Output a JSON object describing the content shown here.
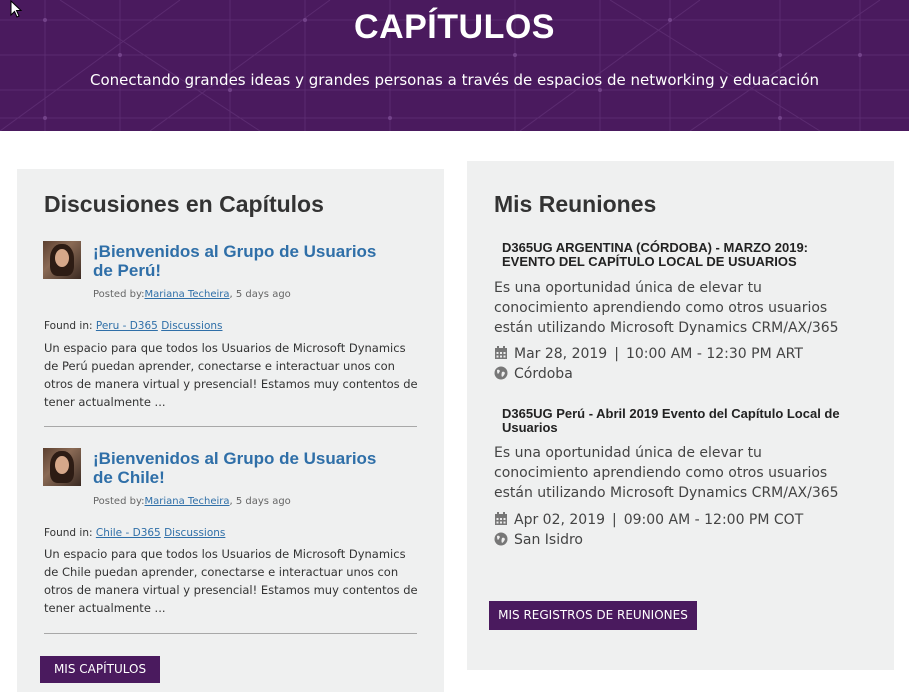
{
  "hero": {
    "title": "CAPÍTULOS",
    "subtitle": "Conectando grandes ideas y grandes personas a través de espacios de networking y eduacación"
  },
  "discussions": {
    "heading": "Discusiones en Capítulos",
    "items": [
      {
        "title_line1": "¡Bienvenidos al Grupo de Usuarios",
        "title_line2": "de Perú!",
        "posted_prefix": "Posted by:",
        "author": "Mariana Techeira",
        "time": ", 5 days ago",
        "found_prefix": "Found in: ",
        "found_group": "Peru - D365",
        "found_forum": "Discussions",
        "excerpt": "Un espacio para que todos los Usuarios de Microsoft Dynamics de Perú puedan aprender, conectarse e interactuar unos con otros de manera virtual y presencial! Estamos muy contentos de tener actualmente ..."
      },
      {
        "title_line1": "¡Bienvenidos al Grupo de Usuarios",
        "title_line2": "de Chile!",
        "posted_prefix": "Posted by:",
        "author": "Mariana Techeira",
        "time": ", 5 days ago",
        "found_prefix": "Found in: ",
        "found_group": "Chile - D365",
        "found_forum": "Discussions",
        "excerpt": "Un espacio para que todos los Usuarios de Microsoft Dynamics de Chile puedan aprender, conectarse e interactuar unos con otros de manera virtual y presencial! Estamos muy contentos de tener actualmente ..."
      }
    ],
    "button": "MIS CAPÍTULOS"
  },
  "meetings": {
    "heading": "Mis Reuniones",
    "items": [
      {
        "title": "D365UG ARGENTINA (CÓRDOBA) - MARZO 2019: EVENTO DEL CAPÍTULO LOCAL DE USUARIOS",
        "description": "Es una oportunidad única de elevar tu conocimiento aprendiendo como otros usuarios están utilizando Microsoft Dynamics CRM/AX/365 ...",
        "date": "Mar 28, 2019",
        "separator": "|",
        "time": "10:00 AM - 12:30 PM ART",
        "location": "Córdoba"
      },
      {
        "title": "D365UG Perú - Abril 2019 Evento del Capítulo Local de Usuarios",
        "description": "Es una oportunidad única de elevar tu conocimiento aprendiendo como otros usuarios están utilizando Microsoft Dynamics CRM/AX/365 ...",
        "date": "Apr 02, 2019",
        "separator": "|",
        "time": "09:00 AM - 12:00 PM COT",
        "location": "San Isidro"
      }
    ],
    "button": "MIS REGISTROS DE REUNIONES"
  },
  "colors": {
    "brand_purple": "#4a1a5e",
    "link_blue": "#2f6fa8",
    "panel_gray": "#eff0f0"
  },
  "icons": {
    "calendar": "calendar-icon",
    "location": "globe-icon",
    "cursor": "mouse-cursor-icon"
  }
}
